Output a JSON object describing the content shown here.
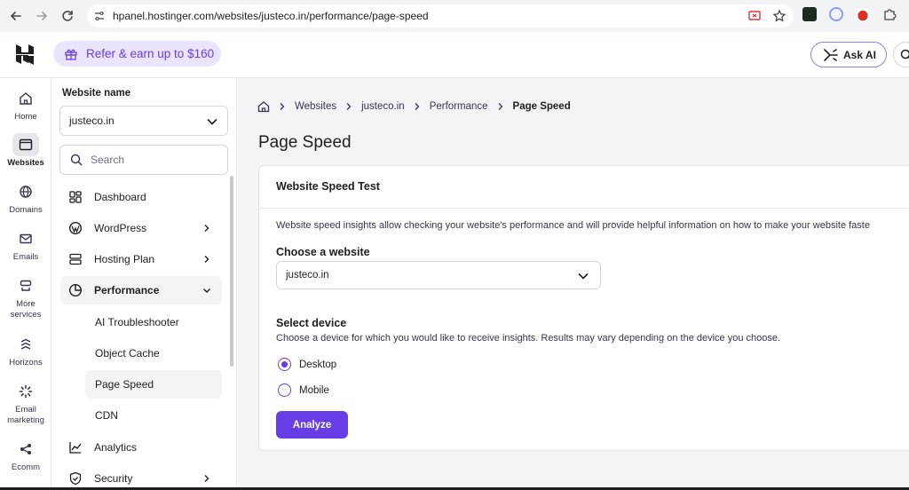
{
  "browser": {
    "url": "hpanel.hostinger.com/websites/justeco.in/performance/page-speed"
  },
  "header": {
    "refer_label": "Refer & earn up to $160",
    "ask_ai_label": "Ask AI"
  },
  "rail": {
    "items": [
      {
        "label": "Home"
      },
      {
        "label": "Websites"
      },
      {
        "label": "Domains"
      },
      {
        "label": "Emails"
      },
      {
        "label": "More services"
      },
      {
        "label": "Horizons"
      },
      {
        "label": "Email marketing"
      },
      {
        "label": "Ecomm"
      }
    ]
  },
  "sidebar": {
    "title": "Website name",
    "selected_website": "justeco.in",
    "search_placeholder": "Search",
    "items": [
      {
        "label": "Dashboard"
      },
      {
        "label": "WordPress"
      },
      {
        "label": "Hosting Plan"
      },
      {
        "label": "Performance"
      },
      {
        "label": "Analytics"
      },
      {
        "label": "Security"
      }
    ],
    "sub_items": [
      {
        "label": "AI Troubleshooter"
      },
      {
        "label": "Object Cache"
      },
      {
        "label": "Page Speed"
      },
      {
        "label": "CDN"
      }
    ]
  },
  "breadcrumb": {
    "items": [
      "Websites",
      "justeco.in",
      "Performance"
    ],
    "current": "Page Speed"
  },
  "page": {
    "title": "Page Speed"
  },
  "card": {
    "title": "Website Speed Test",
    "description": "Website speed insights allow checking your website's performance and will provide helpful information on how to make your website faste",
    "choose_label": "Choose a website",
    "selected_website": "justeco.in",
    "device_label": "Select device",
    "device_description": "Choose a device for which you would like to receive insights. Results may vary depending on the device you choose.",
    "devices": [
      {
        "label": "Desktop",
        "checked": true
      },
      {
        "label": "Mobile",
        "checked": false
      }
    ],
    "analyze_label": "Analyze"
  },
  "colors": {
    "accent": "#673de6",
    "accent_soft": "#ebe4ff",
    "background": "#f4f4f6"
  }
}
